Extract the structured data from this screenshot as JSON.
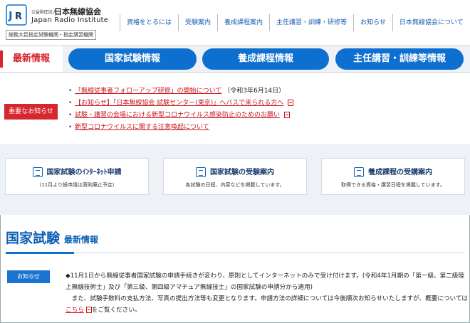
{
  "brand": {
    "small_label": "公益財団法人",
    "name_jp": "日本無線協会",
    "name_en": "Japan Radio Institute",
    "designation": "総務大臣指定試験機関・指定講習機関",
    "accent_color": "#0d6fd0"
  },
  "nav": {
    "items": [
      {
        "label": "資格をとるには"
      },
      {
        "label": "受験案内"
      },
      {
        "label": "養成課程案内"
      },
      {
        "label": "主任講習・訓練・研修等"
      },
      {
        "label": "お知らせ"
      },
      {
        "label": "日本無線協会について"
      }
    ]
  },
  "tabs": {
    "news_label": "最新情報",
    "pills": [
      {
        "label": "国家試験情報"
      },
      {
        "label": "養成課程情報"
      },
      {
        "label": "主任講習・訓練等情報"
      }
    ]
  },
  "important": {
    "badge": "重要なお知らせ",
    "items": [
      {
        "text": "「無線従事者フォローアップ研修」の開始について",
        "note": "（令和3年6月14日）",
        "pdf": false
      },
      {
        "text": "【お知らせ】「日本無線協会 試験センター(東京)」へバスで来られる方へ",
        "note": "",
        "pdf": true
      },
      {
        "text": "試験・講習の会場における新型コロナウイルス感染防止のためのお願い",
        "note": "",
        "pdf": true
      },
      {
        "text": "新型コロナウイルスに関する注意喚起について",
        "note": "",
        "pdf": false
      }
    ]
  },
  "cards": [
    {
      "title": "国家試験のｲﾝﾀｰﾈｯﾄ申請",
      "desc": "（11月より紙申請は原則廃止予定）",
      "icon": "satellite-dish-icon"
    },
    {
      "title": "国家試験の受験案内",
      "desc": "各試験の日程、内容などを掲載しています。",
      "icon": "document-list-icon"
    },
    {
      "title": "養成課程の受講案内",
      "desc": "取得できる資格・講習日程を掲載しています。",
      "icon": "book-icon"
    }
  ],
  "section": {
    "title": "国家試験",
    "subtitle": "最新情報"
  },
  "news": {
    "badge": "お知らせ",
    "line1": "◆11月1日から無線従事者国家試験の申請手続きが変わり、原則としてインターネットのみで受け付けます。(令和4年1月期の「第一級、第二級陸",
    "line2": "上無線技術士」及び「第三級、第四級アマチュア無線技士」の国家試験の申請分から適用)",
    "line3": "　また、試験手数料の支払方法、写真の提出方法等も変更となります。申請方法の詳細については今後順次お知らせいたしますが、概要については",
    "line4_link": "こちら",
    "line4_rest": "をご覧ください。"
  }
}
